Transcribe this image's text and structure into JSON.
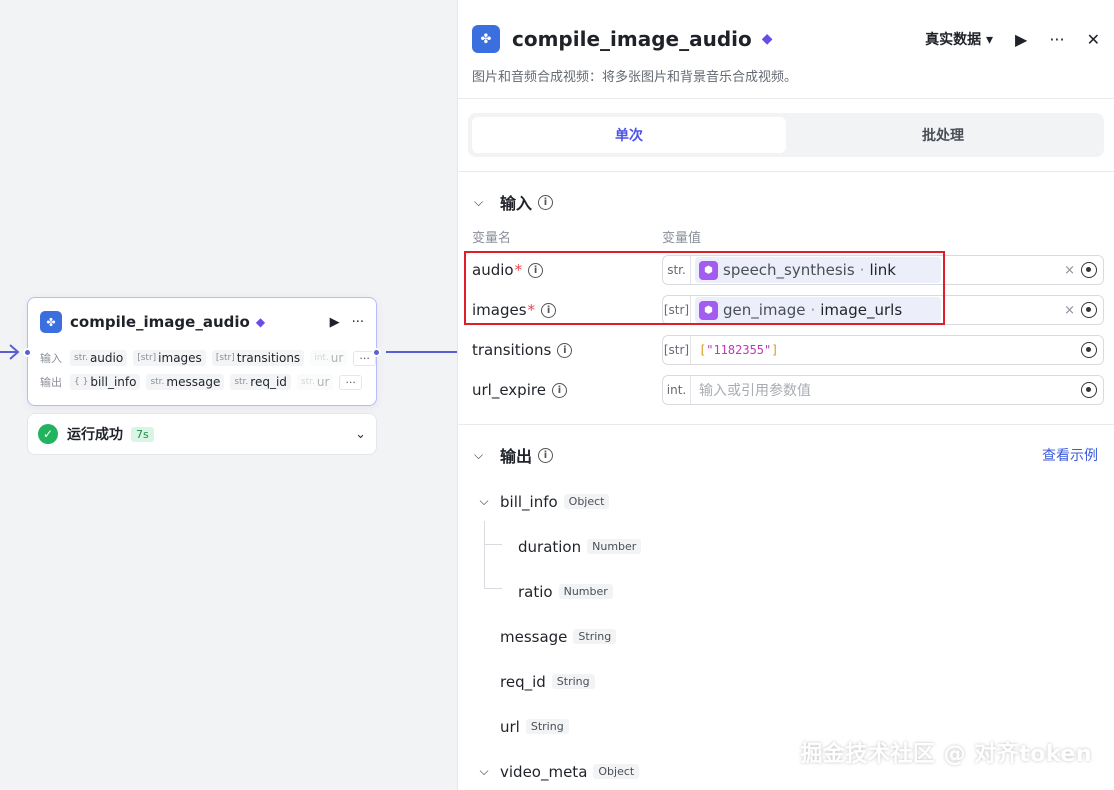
{
  "canvas": {
    "node": {
      "title": "compile_image_audio",
      "input_label": "输入",
      "output_label": "输出",
      "inputs": [
        {
          "type": "str.",
          "name": "audio"
        },
        {
          "type": "[str]",
          "name": "images"
        },
        {
          "type": "[str]",
          "name": "transitions"
        },
        {
          "type": "int.",
          "name": "ur"
        }
      ],
      "outputs": [
        {
          "type": "{ }",
          "name": "bill_info"
        },
        {
          "type": "str.",
          "name": "message"
        },
        {
          "type": "str.",
          "name": "req_id"
        },
        {
          "type": "str.",
          "name": "ur"
        }
      ],
      "more_label": "···"
    },
    "status": {
      "text": "运行成功",
      "time": "7s"
    }
  },
  "panel": {
    "title": "compile_image_audio",
    "mode": "真实数据",
    "description": "图片和音频合成视频：将多张图片和背景音乐合成视频。",
    "tabs": [
      "单次",
      "批处理"
    ],
    "input_section": {
      "title": "输入",
      "col_name": "变量名",
      "col_value": "变量值",
      "fields": [
        {
          "name": "audio",
          "required": "*",
          "type": "str.",
          "ref_node": "speech_synthesis",
          "ref_var": "link",
          "clear": "×"
        },
        {
          "name": "images",
          "required": "*",
          "type": "[str]",
          "ref_node": "gen_image",
          "ref_var": "image_urls",
          "clear": "×"
        },
        {
          "name": "transitions",
          "type": "[str]",
          "value_open": "[",
          "value_str": "\"1182355\"",
          "value_close": "]"
        },
        {
          "name": "url_expire",
          "type": "int.",
          "placeholder": "输入或引用参数值"
        }
      ]
    },
    "output_section": {
      "title": "输出",
      "link": "查看示例",
      "items": [
        {
          "name": "bill_info",
          "type": "Object"
        },
        {
          "name": "duration",
          "type": "Number"
        },
        {
          "name": "ratio",
          "type": "Number"
        },
        {
          "name": "message",
          "type": "String"
        },
        {
          "name": "req_id",
          "type": "String"
        },
        {
          "name": "url",
          "type": "String"
        },
        {
          "name": "video_meta",
          "type": "Object"
        }
      ]
    }
  },
  "watermark": "掘金技术社区 @ 对齐token",
  "colors": {
    "accent": "#4d53e8",
    "success": "#22b35e",
    "highlight": "#e01e2b"
  }
}
